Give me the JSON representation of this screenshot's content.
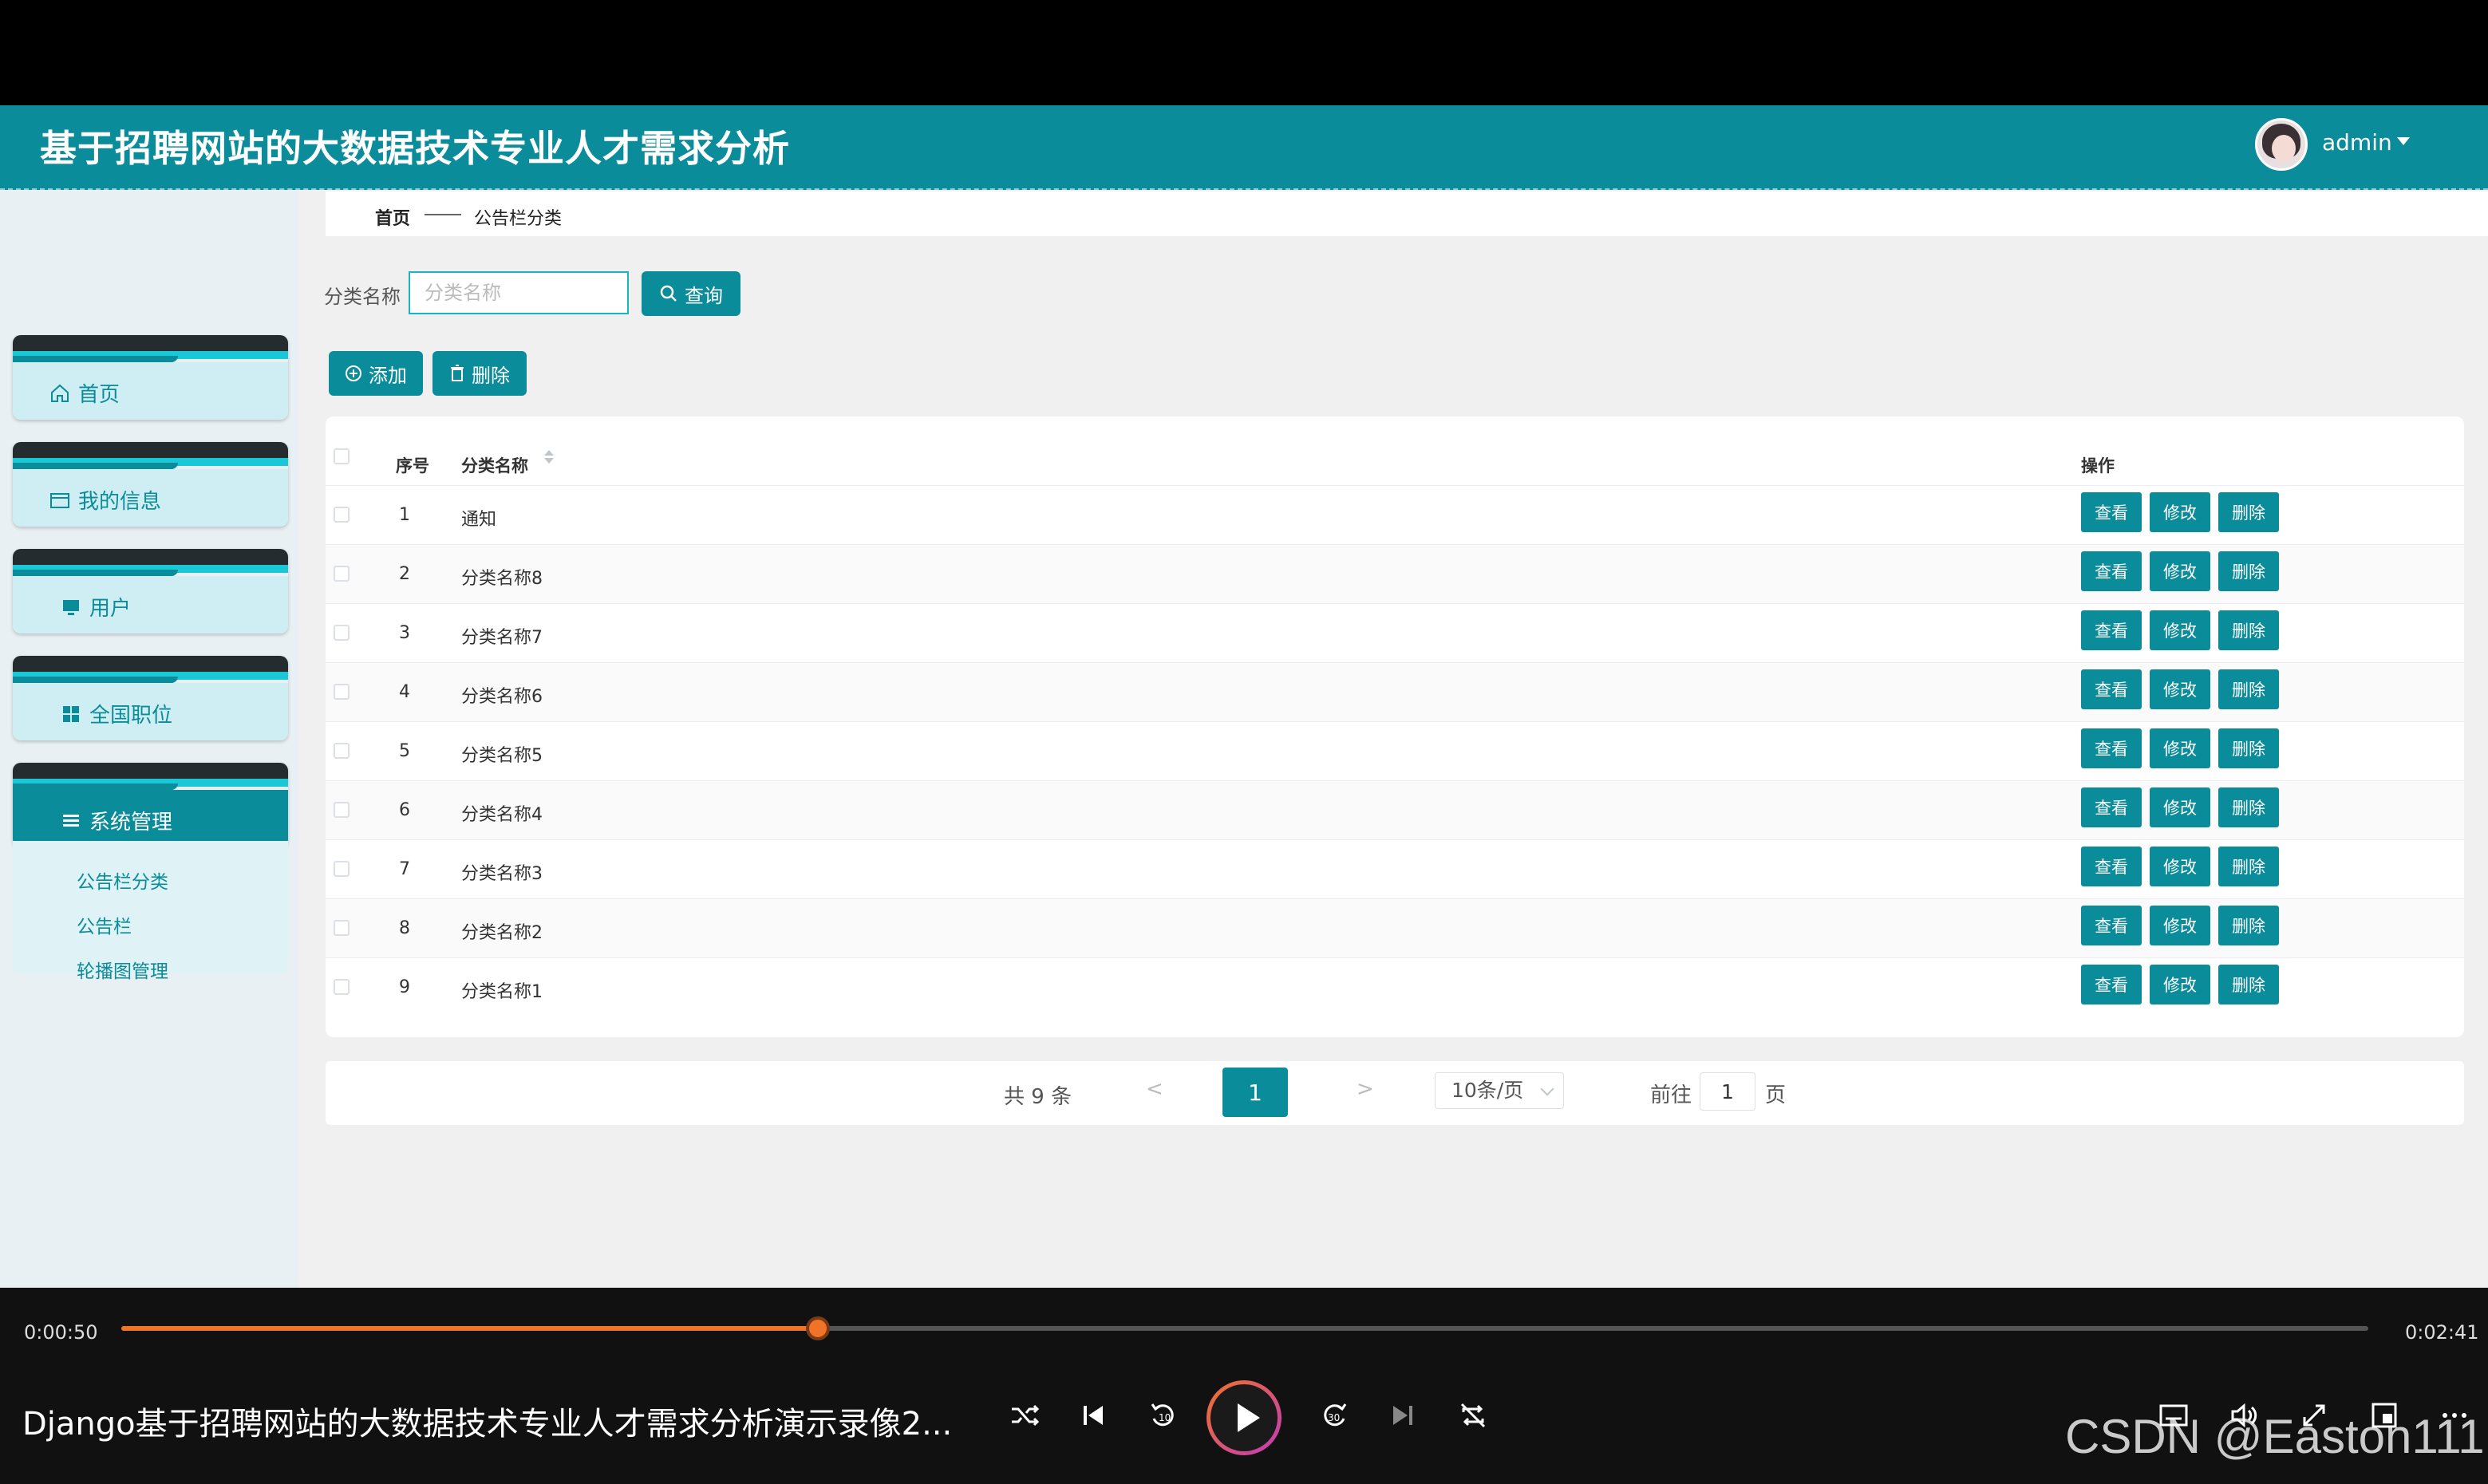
{
  "header": {
    "title": "基于招聘网站的大数据技术专业人才需求分析",
    "user": "admin"
  },
  "sidebar": {
    "items": [
      {
        "label": "首页",
        "icon": "home-icon"
      },
      {
        "label": "我的信息",
        "icon": "id-card-icon"
      },
      {
        "label": "用户",
        "icon": "monitor-icon"
      },
      {
        "label": "全国职位",
        "icon": "grid-icon"
      },
      {
        "label": "系统管理",
        "icon": "menu-icon"
      }
    ],
    "subitems": [
      "公告栏分类",
      "公告栏",
      "轮播图管理"
    ]
  },
  "breadcrumb": {
    "home": "首页",
    "current": "公告栏分类"
  },
  "search": {
    "label": "分类名称",
    "placeholder": "分类名称",
    "button": "查询"
  },
  "toolbar": {
    "add": "添加",
    "delete": "删除"
  },
  "table": {
    "headers": {
      "index": "序号",
      "name": "分类名称",
      "actions": "操作"
    },
    "rows": [
      {
        "index": "1",
        "name": "通知"
      },
      {
        "index": "2",
        "name": "分类名称8"
      },
      {
        "index": "3",
        "name": "分类名称7"
      },
      {
        "index": "4",
        "name": "分类名称6"
      },
      {
        "index": "5",
        "name": "分类名称5"
      },
      {
        "index": "6",
        "name": "分类名称4"
      },
      {
        "index": "7",
        "name": "分类名称3"
      },
      {
        "index": "8",
        "name": "分类名称2"
      },
      {
        "index": "9",
        "name": "分类名称1"
      }
    ],
    "row_actions": {
      "view": "查看",
      "edit": "修改",
      "delete": "删除"
    }
  },
  "pagination": {
    "total": "共 9 条",
    "prev": "<",
    "current": "1",
    "next": ">",
    "page_size": "10条/页",
    "goto_prefix": "前往",
    "goto_value": "1",
    "goto_suffix": "页"
  },
  "player": {
    "elapsed": "0:00:50",
    "duration": "0:02:41",
    "progress": 0.31,
    "title": "Django基于招聘网站的大数据技术专业人才需求分析演示录像2...",
    "watermark": "CSDN @Easton111"
  },
  "colors": {
    "primary": "#0b8c9a",
    "progress": "#f07428"
  }
}
